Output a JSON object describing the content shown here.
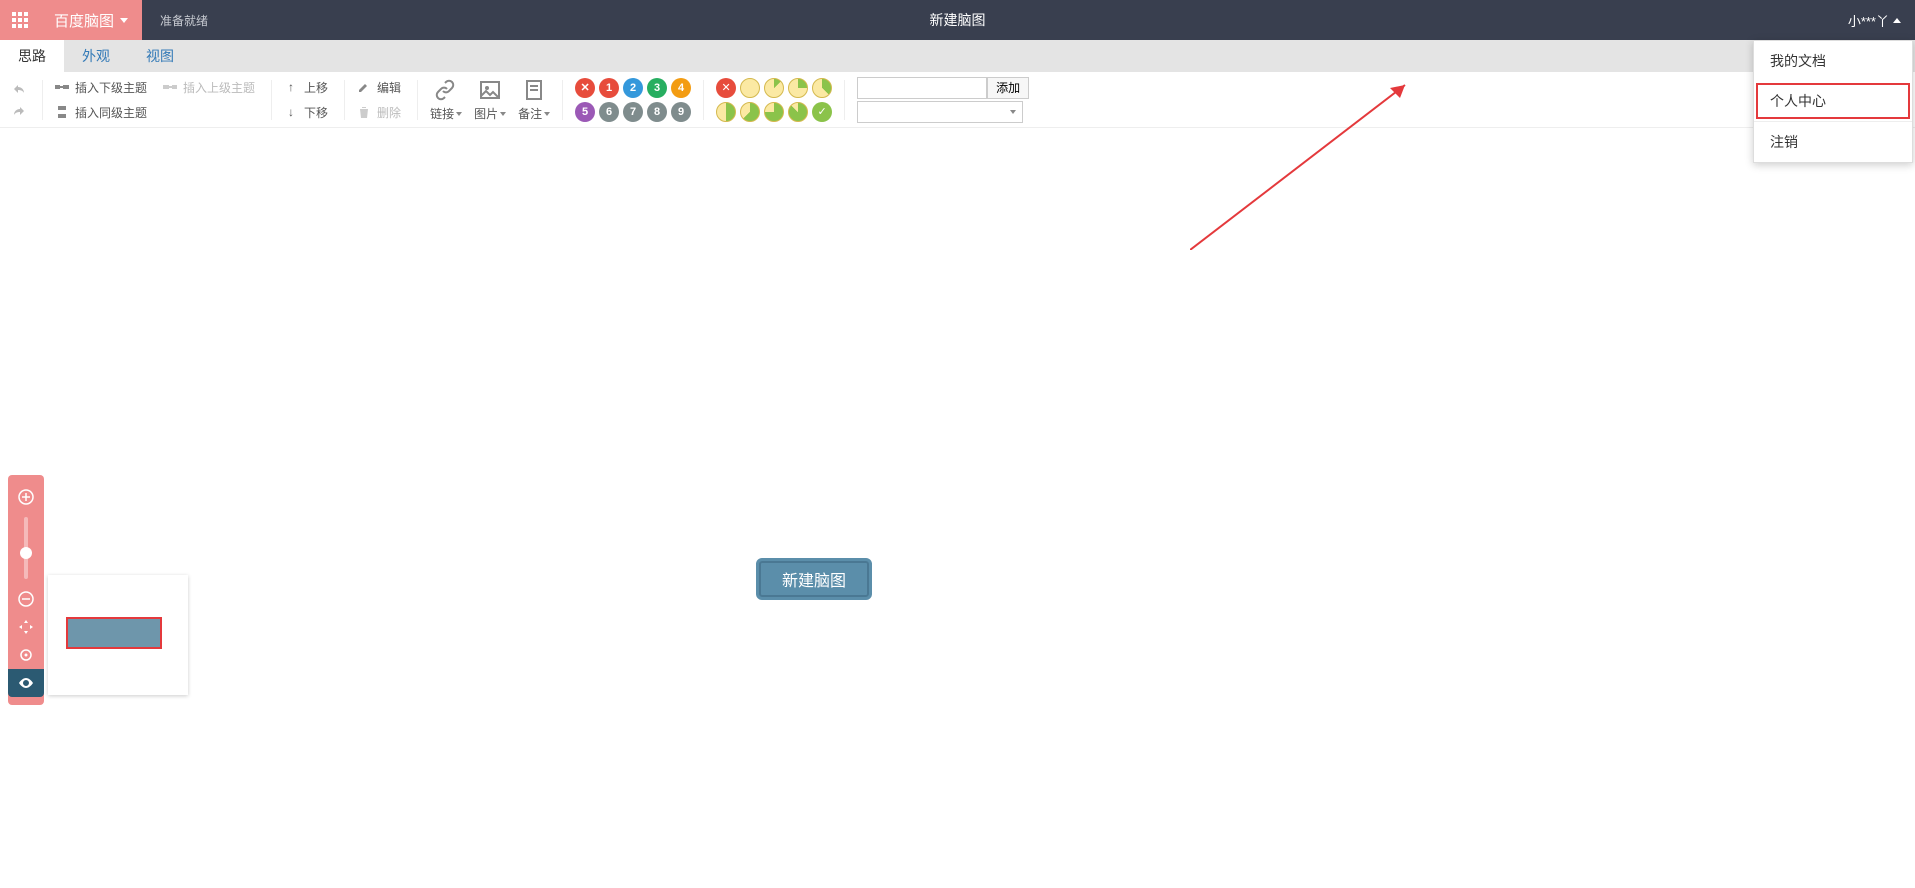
{
  "header": {
    "brand": "百度脑图",
    "status": "准备就绪",
    "doc_title": "新建脑图",
    "user": "小***丫"
  },
  "tabs": [
    {
      "label": "思路",
      "active": true
    },
    {
      "label": "外观",
      "active": false
    },
    {
      "label": "视图",
      "active": false
    }
  ],
  "toolbar": {
    "insert_child": "插入下级主题",
    "insert_parent": "插入上级主题",
    "insert_sibling": "插入同级主题",
    "move_up": "上移",
    "move_down": "下移",
    "edit": "编辑",
    "delete": "删除",
    "link": "链接",
    "image": "图片",
    "note": "备注",
    "priority_nums": [
      "1",
      "2",
      "3",
      "4",
      "5",
      "6",
      "7",
      "8",
      "9"
    ],
    "resource_add": "添加"
  },
  "canvas": {
    "root_node": "新建脑图"
  },
  "user_menu": {
    "my_docs": "我的文档",
    "profile": "个人中心",
    "logout": "注销"
  }
}
